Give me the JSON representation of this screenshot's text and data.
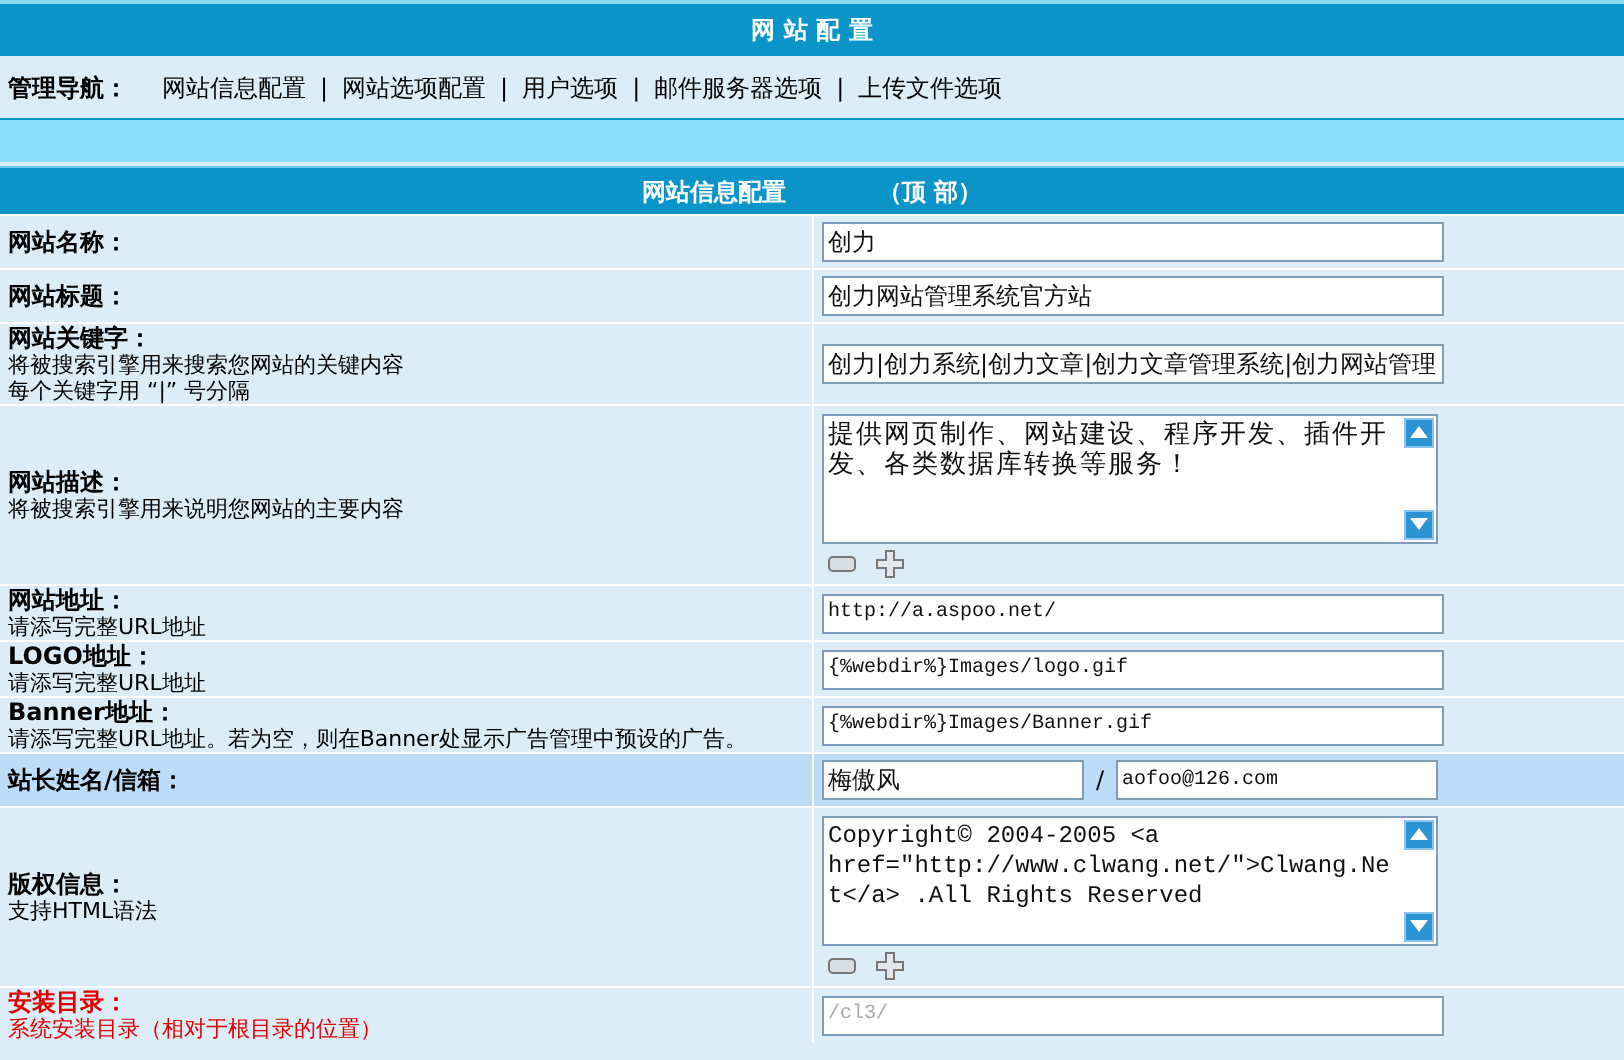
{
  "header": {
    "title": "网 站 配 置"
  },
  "nav": {
    "label": "管理导航：",
    "items": [
      "网站信息配置",
      "网站选项配置",
      "用户选项",
      "邮件服务器选项",
      "上传文件选项"
    ],
    "separators": [
      "|",
      "|",
      "|",
      "|"
    ]
  },
  "section": {
    "title": "网站信息配置",
    "suffix": "（顶 部）"
  },
  "rows": [
    {
      "kind": "input",
      "label": "网站名称：",
      "hints": [],
      "value": "创力",
      "highlighted": false,
      "warning": false
    },
    {
      "kind": "input",
      "label": "网站标题：",
      "hints": [],
      "value": "创力网站管理系统官方站",
      "highlighted": false,
      "warning": false
    },
    {
      "kind": "input",
      "label": "网站关键字：",
      "hints": [
        "将被搜索引擎用来搜索您网站的关键内容",
        "每个关键字用 “|” 号分隔"
      ],
      "value": "创力|创力系统|创力文章|创力文章管理系统|创力网站管理",
      "highlighted": false,
      "warning": false
    },
    {
      "kind": "textarea",
      "label": "网站描述：",
      "hints": [
        "将被搜索引擎用来说明您网站的主要内容"
      ],
      "value": "提供网页制作、网站建设、程序开发、插件开发、各类数据库转换等服务！",
      "highlighted": false,
      "warning": false,
      "mono": false
    },
    {
      "kind": "input",
      "label": "网站地址：",
      "hints": [
        "请添写完整URL地址"
      ],
      "value": "http://a.aspoo.net/",
      "highlighted": false,
      "warning": false,
      "mono": true
    },
    {
      "kind": "input",
      "label": "LOGO地址：",
      "hints": [
        "请添写完整URL地址"
      ],
      "value": "{%webdir%}Images/logo.gif",
      "highlighted": false,
      "warning": false,
      "mono": true
    },
    {
      "kind": "input",
      "label": "Banner地址：",
      "hints": [
        "请添写完整URL地址。若为空，则在Banner处显示广告管理中预设的广告。"
      ],
      "value": "{%webdir%}Images/Banner.gif",
      "highlighted": false,
      "warning": false,
      "mono": true
    },
    {
      "kind": "pair",
      "label": "站长姓名/信箱：",
      "hints": [],
      "value": "梅傲风",
      "separator": "/",
      "value2": "aofoo@126.com",
      "highlighted": true,
      "warning": false
    },
    {
      "kind": "textarea",
      "label": "版权信息：",
      "hints": [
        "支持HTML语法"
      ],
      "value": "Copyright© 2004-2005 <a href=\"http://www.clwang.net/\">Clwang.Net</a> .All Rights Reserved",
      "highlighted": false,
      "warning": false,
      "mono": true
    },
    {
      "kind": "input",
      "label": "安装目录：",
      "hints": [
        "系统安装目录（相对于根目录的位置）"
      ],
      "value": "/cl3/",
      "highlighted": false,
      "warning": true,
      "mono": true,
      "disabled": true
    }
  ]
}
